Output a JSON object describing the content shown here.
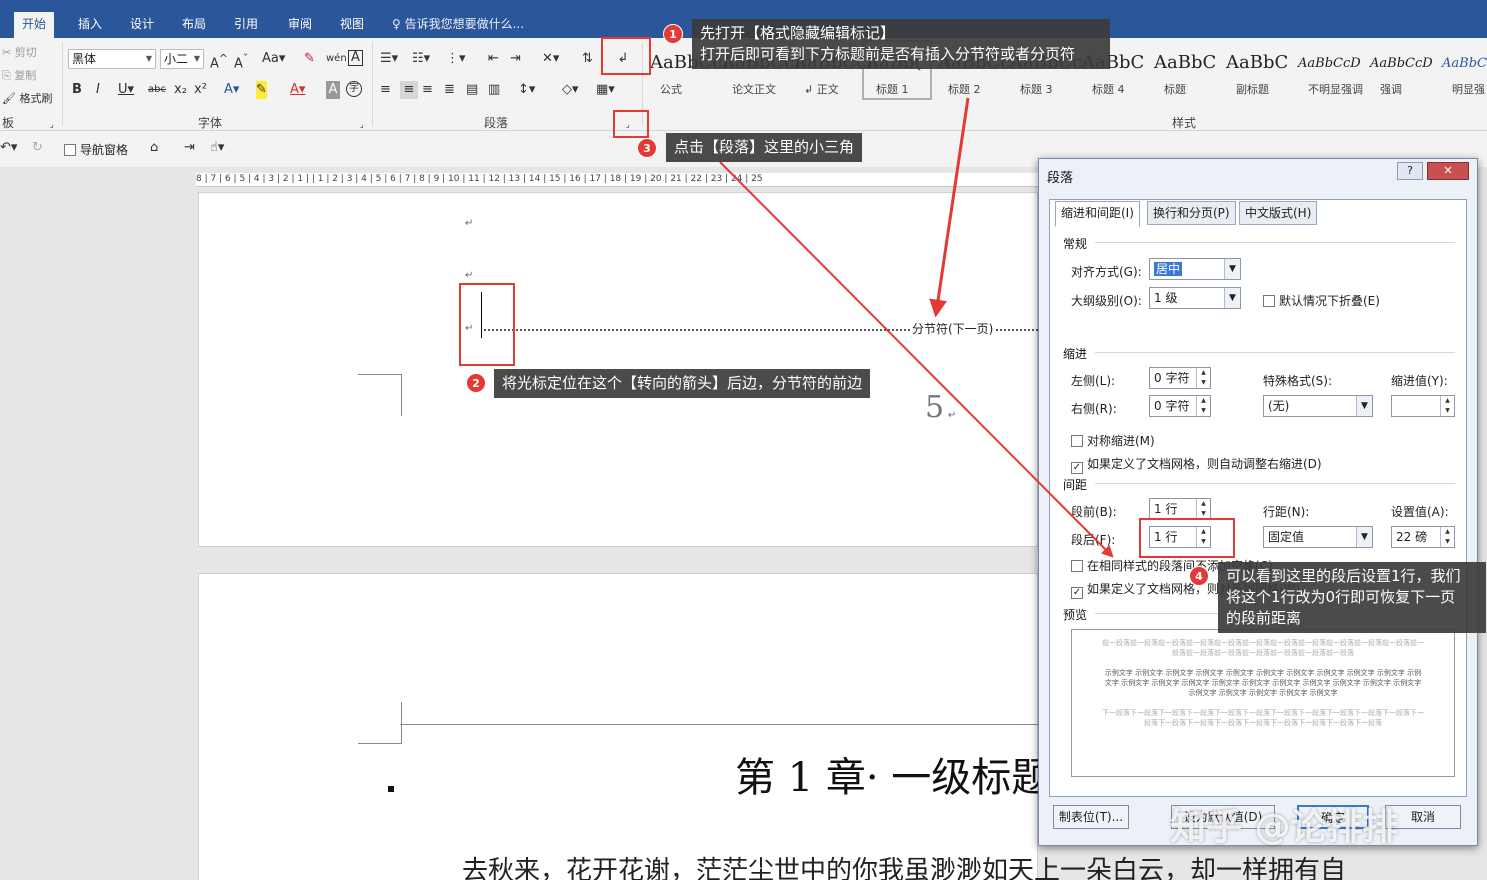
{
  "tabs": [
    "开始",
    "插入",
    "设计",
    "布局",
    "引用",
    "审阅",
    "视图"
  ],
  "tell_me": "告诉我您想要做什么...",
  "clipboard": {
    "cut": "剪切",
    "copy": "复制",
    "format_painter": "格式刷",
    "group": "板"
  },
  "font": {
    "name": "黑体",
    "size": "小二",
    "group": "字体"
  },
  "paragraph_group": "段落",
  "styles_group": "样式",
  "styles": [
    {
      "preview": "AaBbCcI",
      "name": "公式"
    },
    {
      "preview": "AaBbCcI",
      "name": "论文正文"
    },
    {
      "preview": "AaBbCcI",
      "name": "↲ 正文"
    },
    {
      "preview": "AaBb(",
      "name": "标题 1"
    },
    {
      "preview": "AaBbCc",
      "name": "标题 2"
    },
    {
      "preview": "AaBbCc",
      "name": "标题 3"
    },
    {
      "preview": "AaBbC",
      "name": "标题 4"
    },
    {
      "preview": "AaBbC",
      "name": "标题"
    },
    {
      "preview": "AaBbC",
      "name": "副标题"
    },
    {
      "preview": "AaBbCcD",
      "name": "不明显强调"
    },
    {
      "preview": "AaBbCcD",
      "name": "强调"
    },
    {
      "preview": "AaBbCc",
      "name": "明显强"
    }
  ],
  "qat": {
    "nav_pane": "导航窗格"
  },
  "ruler": "8 | 7 | 6 | 5 | 4 | 3 | 2 | 1 |   | 1 | 2 | 3 | 4 | 5 | 6 | 7 | 8 | 9 | 10 | 11 | 12 | 13 | 14 | 15 | 16 | 17 | 18 | 19 | 20 | 21 | 22 | 23 | 24 | 25",
  "doc": {
    "section_break": "分节符(下一页)",
    "page_number": "5",
    "chapter_title": "第 1 章· 一级标题",
    "body_text": "去秋来，花开花谢，茫茫尘世中的你我虽渺渺如天上一朵白云，却一样拥有自"
  },
  "annotations": {
    "step1_num": "1",
    "step1_line1": "先打开【格式隐藏编辑标记】",
    "step1_line2": "打开后即可看到下方标题前是否有插入分节符或者分页符",
    "step2_num": "2",
    "step2": "将光标定位在这个【转向的箭头】后边，分节符的前边",
    "step3_num": "3",
    "step3": "点击【段落】这里的小三角",
    "step4_num": "4",
    "step4_line1": "可以看到这里的段后设置1行，我们",
    "step4_line2": "将这个1行改为0行即可恢复下一页",
    "step4_line3": "的段前距离"
  },
  "dialog": {
    "title": "段落",
    "help": "?",
    "close": "✕",
    "tabs": [
      "缩进和间距(I)",
      "换行和分页(P)",
      "中文版式(H)"
    ],
    "general": "常规",
    "alignment_label": "对齐方式(G):",
    "alignment_value": "居中",
    "outline_label": "大纲级别(O):",
    "outline_value": "1 级",
    "collapse_label": "默认情况下折叠(E)",
    "indent": "缩进",
    "left_label": "左侧(L):",
    "left_value": "0 字符",
    "right_label": "右侧(R):",
    "right_value": "0 字符",
    "special_label": "特殊格式(S):",
    "special_value": "(无)",
    "indent_value_label": "缩进值(Y):",
    "mirror_indent": "对称缩进(M)",
    "auto_right": "如果定义了文档网格，则自动调整右缩进(D)",
    "spacing": "间距",
    "before_label": "段前(B):",
    "before_value": "1 行",
    "after_label": "段后(F):",
    "after_value": "1 行",
    "line_spacing_label": "行距(N):",
    "line_spacing_value": "固定值",
    "setting_label": "设置值(A):",
    "setting_value": "22 磅",
    "no_space_same_style": "在相同样式的段落间不添加空格(C)",
    "snap_grid": "如果定义了文档网格，则对齐到网格(W)",
    "preview": "预览",
    "preview_prev": "前一段落前一段落前一段落前一段落前一段落前一段落前一段落前一段落前一段落前一段落前一段落前一段落前一段落前一段落前一段落前一段落前一段落前一段落",
    "preview_sample": "示例文字 示例文字 示例文字 示例文字 示例文字 示例文字 示例文字 示例文字 示例文字 示例文字 示例文字 示例文字 示例文字 示例文字 示例文字 示例文字 示例文字 示例文字 示例文字 示例文字 示例文字 示例文字 示例文字 示例文字 示例文字 示例文字",
    "preview_next": "下一段落下一段落下一段落下一段落下一段落下一段落下一段落下一段落下一段落下一段落下一段落下一段落下一段落下一段落下一段落下一段落下一段落下一段落下一段落下一段落",
    "tabs_button": "制表位(T)...",
    "default_button": "设为默认值(D)",
    "ok_button": "确定",
    "cancel_button": "取消"
  },
  "watermark": "知乎 @论排排"
}
